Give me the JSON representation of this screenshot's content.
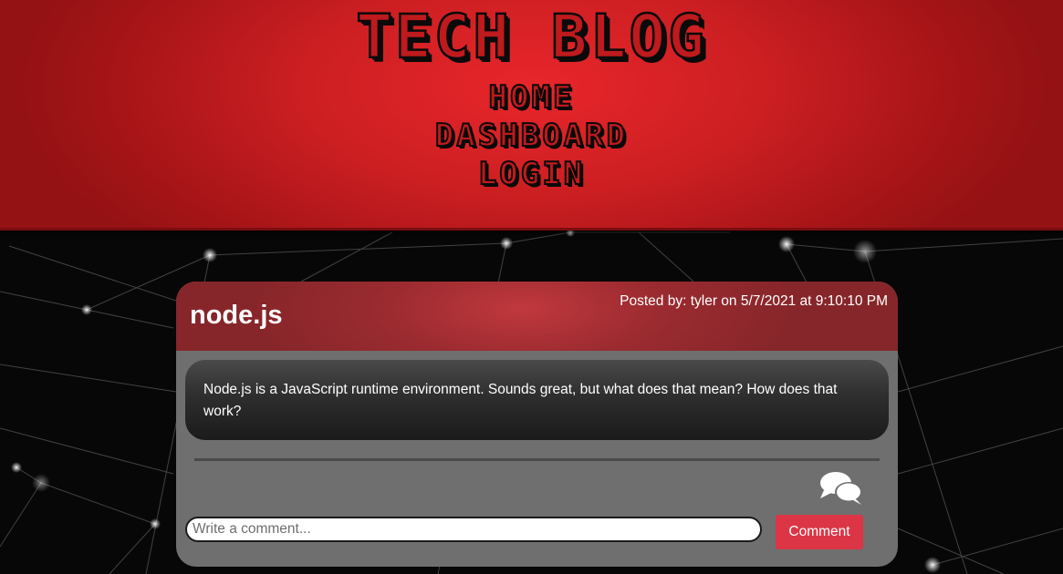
{
  "site": {
    "title": "TECH BLOG",
    "nav": {
      "home": "HOME",
      "dashboard": "DASHBOARD",
      "login": "LOGIN"
    }
  },
  "post": {
    "title": "node.js",
    "meta": "Posted by: tyler on 5/7/2021 at 9:10:10 PM",
    "body": "Node.js is a JavaScript runtime environment. Sounds great, but what does that mean? How does that work?"
  },
  "comment_form": {
    "placeholder": "Write a comment...",
    "value": "",
    "submit_label": "Comment",
    "icon": "comments-icon"
  },
  "colors": {
    "header_red": "#cc1f22",
    "card_gray": "#6f6f6f",
    "button_red": "#dc3545"
  }
}
